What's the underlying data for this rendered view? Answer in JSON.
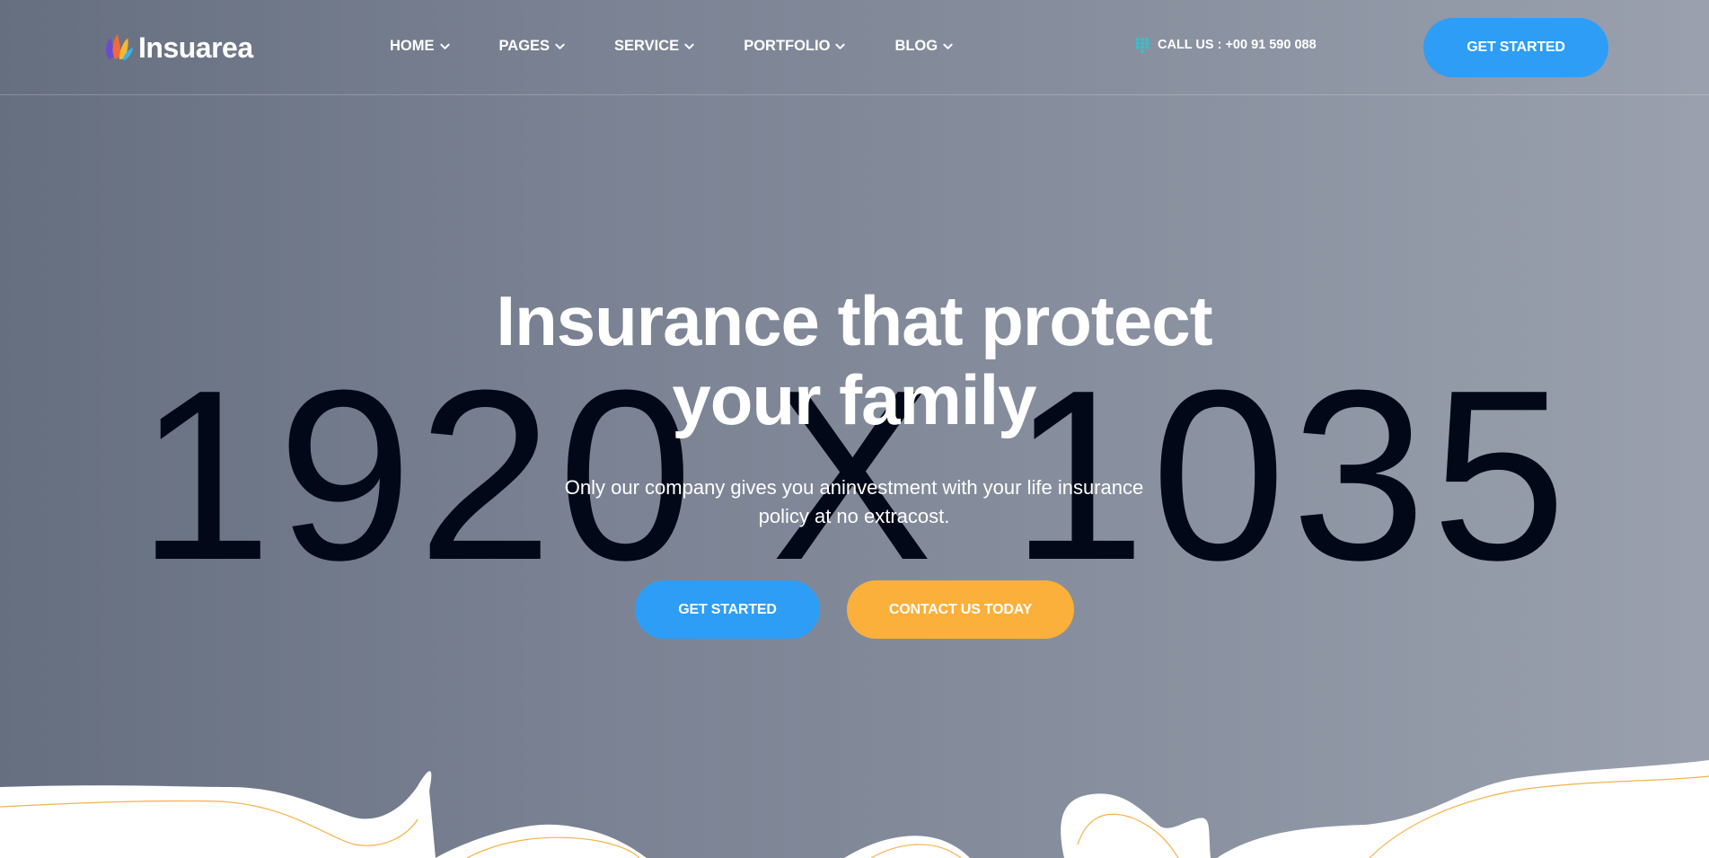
{
  "brand": {
    "name": "Insuarea",
    "logo_icon": "flame-leaf-logo-icon"
  },
  "nav": {
    "items": [
      {
        "label": "HOME"
      },
      {
        "label": "PAGES"
      },
      {
        "label": "SERVICE"
      },
      {
        "label": "PORTFOLIO"
      },
      {
        "label": "BLOG"
      }
    ],
    "dropdown_icon": "chevron-down-icon"
  },
  "contact": {
    "label": "CALL US : +00 91 590 088",
    "icon": "phone-keypad-icon",
    "icon_color": "#2ec4d6"
  },
  "header_cta": {
    "label": "GET STARTED"
  },
  "hero": {
    "placeholder_text": "1920 X 1035",
    "title_line1": "Insurance that protect",
    "title_line2": "your family",
    "subtitle_line1": "Only our company gives you aninvestment with your life insurance",
    "subtitle_line2": "policy at no extracost.",
    "primary_button": "GET STARTED",
    "secondary_button": "CONTACT US TODAY"
  },
  "colors": {
    "primary_blue": "#2e9df6",
    "accent_orange": "#fbb03b",
    "wave_line": "#f6b24a",
    "background_white": "#ffffff"
  }
}
